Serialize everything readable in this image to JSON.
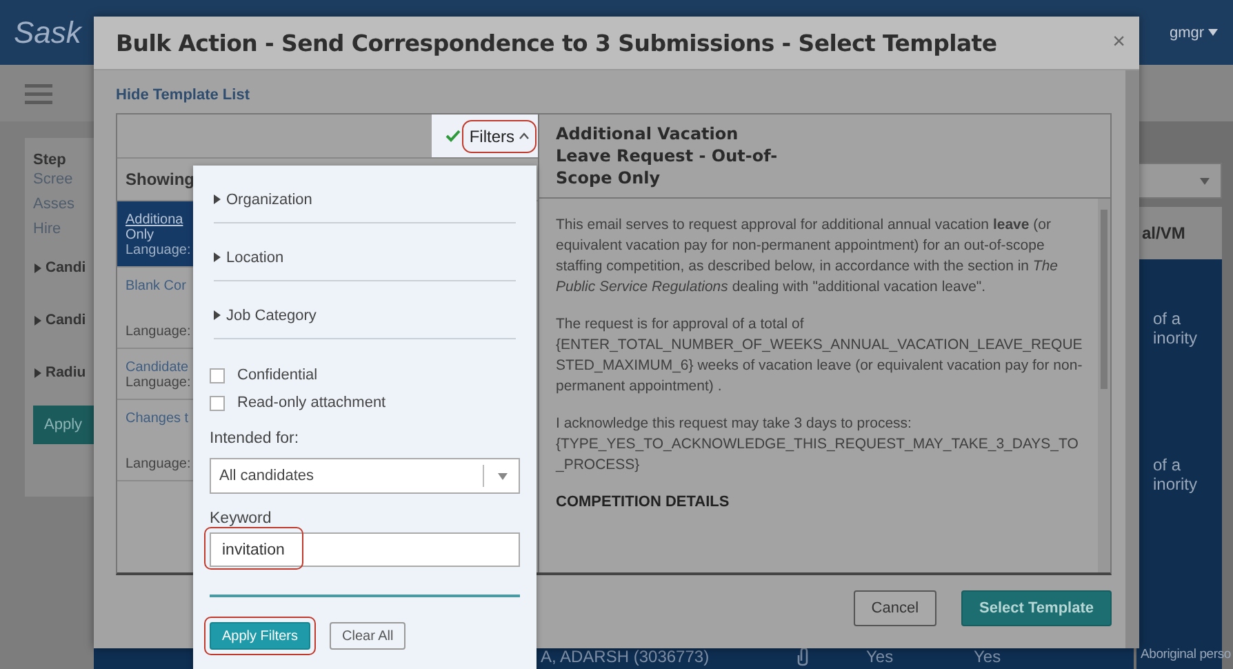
{
  "app": {
    "logo": "Sask",
    "user_menu": "gmgr",
    "menu_open": false
  },
  "sidebar": {
    "step_label": "Step",
    "steps": [
      "Scree",
      "Asses",
      "Hire"
    ],
    "sections": [
      {
        "label": "Candi",
        "expanded": false
      },
      {
        "label": "Candi",
        "expanded": false
      },
      {
        "label": "Radiu",
        "expanded": false
      }
    ],
    "apply_button": "Apply"
  },
  "background_table": {
    "header": "al/VM",
    "cells": [
      [
        "of a",
        "inority"
      ],
      [
        "of a",
        "inority"
      ]
    ],
    "footer_cell": "Aboriginal perso",
    "row": {
      "name": "A, ADARSH (3036773)",
      "column_3": "Yes",
      "column_4": "Yes"
    }
  },
  "modal": {
    "title": "Bulk Action - Send Correspondence to 3 Submissions - Select Template",
    "close": "×",
    "hide_link": "Hide Template List",
    "filters_toggle": {
      "label": "Filters",
      "active": true,
      "expanded": true,
      "highlighted": true
    },
    "showing_label": "Showing",
    "templates": [
      {
        "title_lines": [
          "Additiona",
          "Only"
        ],
        "language": "Language:",
        "selected": true
      },
      {
        "title_lines": [
          "Blank Cor"
        ],
        "language": "Language:",
        "selected": false
      },
      {
        "title_lines": [
          "Candidate"
        ],
        "language": "Language:",
        "selected": false
      },
      {
        "title_lines": [
          "Changes t"
        ],
        "language": "Language:",
        "selected": false
      }
    ],
    "preview": {
      "title": "Additional Vacation Leave Request - Out-of-Scope Only",
      "paragraphs": [
        "This email serves to request approval for additional annual vacation **leave** (or equivalent vacation pay for non-permanent appointment) for an out-of-scope staffing competition, as described below, in accordance with the section in *The Public Service Regulations* dealing with \"additional vacation leave\".",
        "The request is for approval of a total of {ENTER_TOTAL_NUMBER_OF_WEEKS_ANNUAL_VACATION_LEAVE_REQUESTED_MAXIMUM_6} weeks of vacation leave (or equivalent vacation pay for non-permanent appointment) .",
        "I acknowledge this request may take 3 days to process: {TYPE_YES_TO_ACKNOWLEDGE_THIS_REQUEST_MAY_TAKE_3_DAYS_TO_PROCESS}"
      ],
      "heading": "COMPETITION DETAILS"
    },
    "buttons": [
      {
        "label": "Cancel",
        "kind": "secondary"
      },
      {
        "label": "Select Template",
        "kind": "primary"
      }
    ]
  },
  "filter_panel": {
    "sections": [
      {
        "label": "Organization",
        "expanded": false
      },
      {
        "label": "Location",
        "expanded": false
      },
      {
        "label": "Job Category",
        "expanded": false
      }
    ],
    "checkboxes": [
      {
        "label": "Confidential",
        "checked": false
      },
      {
        "label": "Read-only attachment",
        "checked": false
      }
    ],
    "intended_for": {
      "label": "Intended for:",
      "value": "All candidates"
    },
    "keyword": {
      "label": "Keyword",
      "value": "invitation",
      "highlighted": true
    },
    "buttons": [
      {
        "label": "Apply Filters",
        "kind": "primary",
        "highlighted": true
      },
      {
        "label": "Clear All",
        "kind": "secondary"
      }
    ]
  }
}
